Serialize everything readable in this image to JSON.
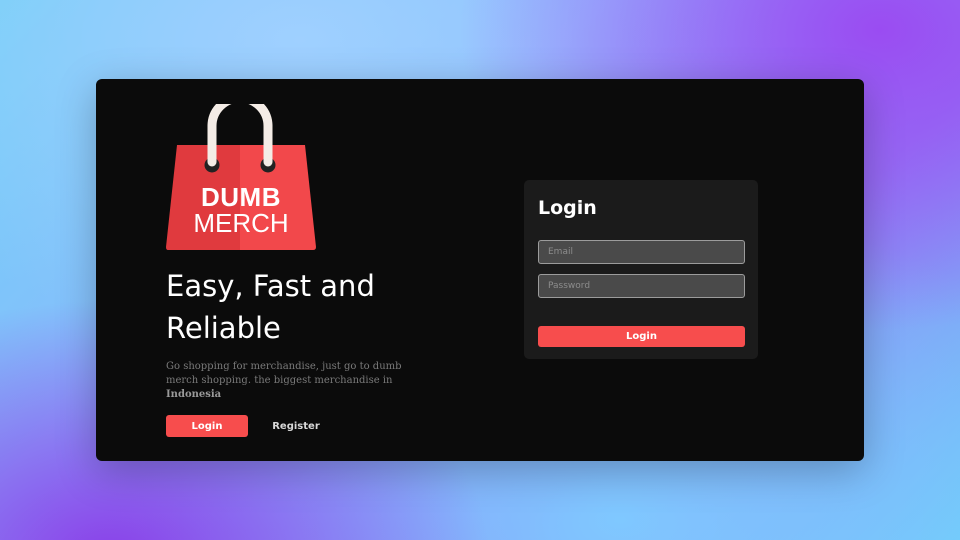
{
  "brand": {
    "logo_line1": "DUMB",
    "logo_line2": "MERCH",
    "colors": {
      "bag_light": "#f2484b",
      "bag_dark": "#e03a3e",
      "handle": "#f4ece6"
    }
  },
  "hero": {
    "headline": "Easy, Fast and Reliable",
    "description_prefix": "Go shopping for merchandise, just go to dumb merch shopping. the biggest merchandise in ",
    "description_highlight": "Indonesia",
    "login_button": "Login",
    "register_button": "Register"
  },
  "login_form": {
    "title": "Login",
    "email_placeholder": "Email",
    "password_placeholder": "Password",
    "submit_button": "Login"
  },
  "theme": {
    "accent": "#f74d4d",
    "card_background": "#0b0b0b",
    "panel_background": "#1b1b1b"
  }
}
